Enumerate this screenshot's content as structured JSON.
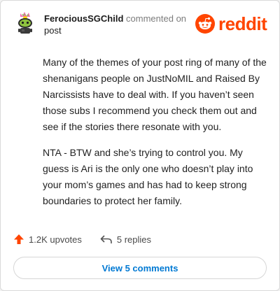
{
  "comment": {
    "username": "FerociousSGChild",
    "action_text": "commented on",
    "target_text": "post",
    "paragraphs": [
      "Many of the themes of your post ring of many of the shenanigans people on JustNoMIL and Raised By Narcissists have to deal with. If you haven’t seen those subs I recommend you check them out and see if the stories there resonate with you.",
      "NTA - BTW and she’s trying to control you. My guess is Ari is the only one who doesn’t play into your mom’s games and has had to keep strong boundaries to protect her family."
    ]
  },
  "brand": {
    "wordmark": "reddit",
    "color": "#ff4500"
  },
  "actions": {
    "upvotes_label": "1.2K upvotes",
    "replies_label": "5 replies"
  },
  "view_button_label": "View 5 comments",
  "colors": {
    "link": "#0079d3",
    "upvote": "#ff4500"
  }
}
